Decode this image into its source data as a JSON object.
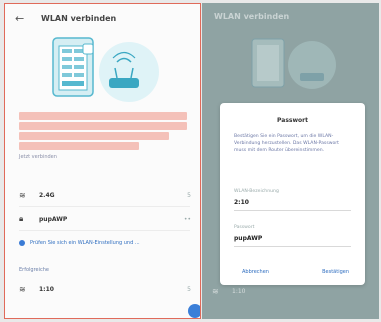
{
  "left": {
    "title": "WLAN verbinden",
    "warning_text": "Jetzt verbinden",
    "rows": [
      {
        "label": "2.4G",
        "trail": "5"
      },
      {
        "label": "pupAWP",
        "trail": "••"
      }
    ],
    "hint": "Prüfen Sie sich ein WLAN-Einstellung und ...",
    "section": "Erfolgreiche",
    "last_row": {
      "label": "1:10",
      "trail": "5"
    }
  },
  "right": {
    "bg_title": "WLAN verbinden",
    "bg_row": "1:10",
    "dialog": {
      "title": "Passwort",
      "body": "Bestätigen Sie ein Passwort, um die WLAN-Verbindung herzustellen. Das WLAN-Passwort muss mit dem Router übereinstimmen.",
      "ssid_label": "WLAN-Bezeichnung",
      "ssid_value": "2:10",
      "password_label": "Passwort",
      "password_value": "pupAWP",
      "cancel_label": "Abbrechen",
      "confirm_label": "Bestätigen"
    }
  },
  "colors": {
    "accent": "#3b7fd8",
    "warning_block": "#f2b6ad",
    "frame_red": "#e06a5a",
    "dim_bg": "#8fa3a3"
  }
}
